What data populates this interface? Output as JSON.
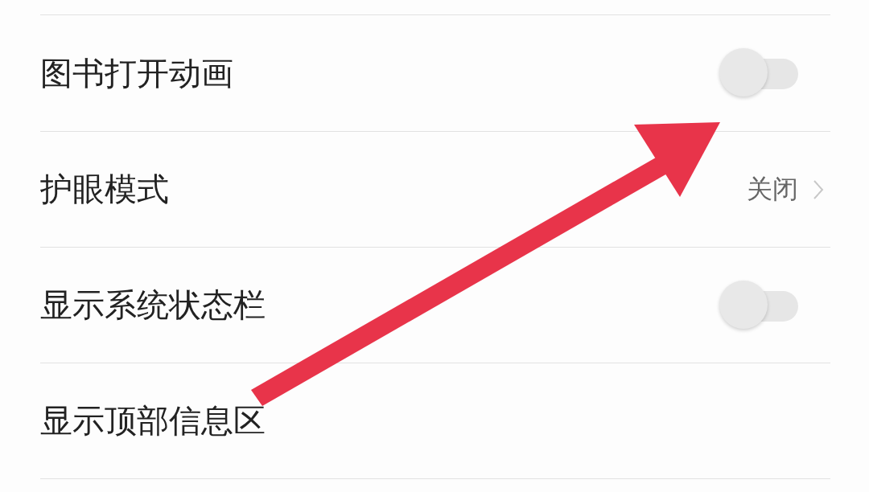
{
  "settings": [
    {
      "label": "图书打开动画",
      "kind": "toggle",
      "on": false
    },
    {
      "label": "护眼模式",
      "kind": "value",
      "value": "关闭"
    },
    {
      "label": "显示系统状态栏",
      "kind": "toggle",
      "on": false
    },
    {
      "label": "显示顶部信息区",
      "kind": "label"
    }
  ]
}
